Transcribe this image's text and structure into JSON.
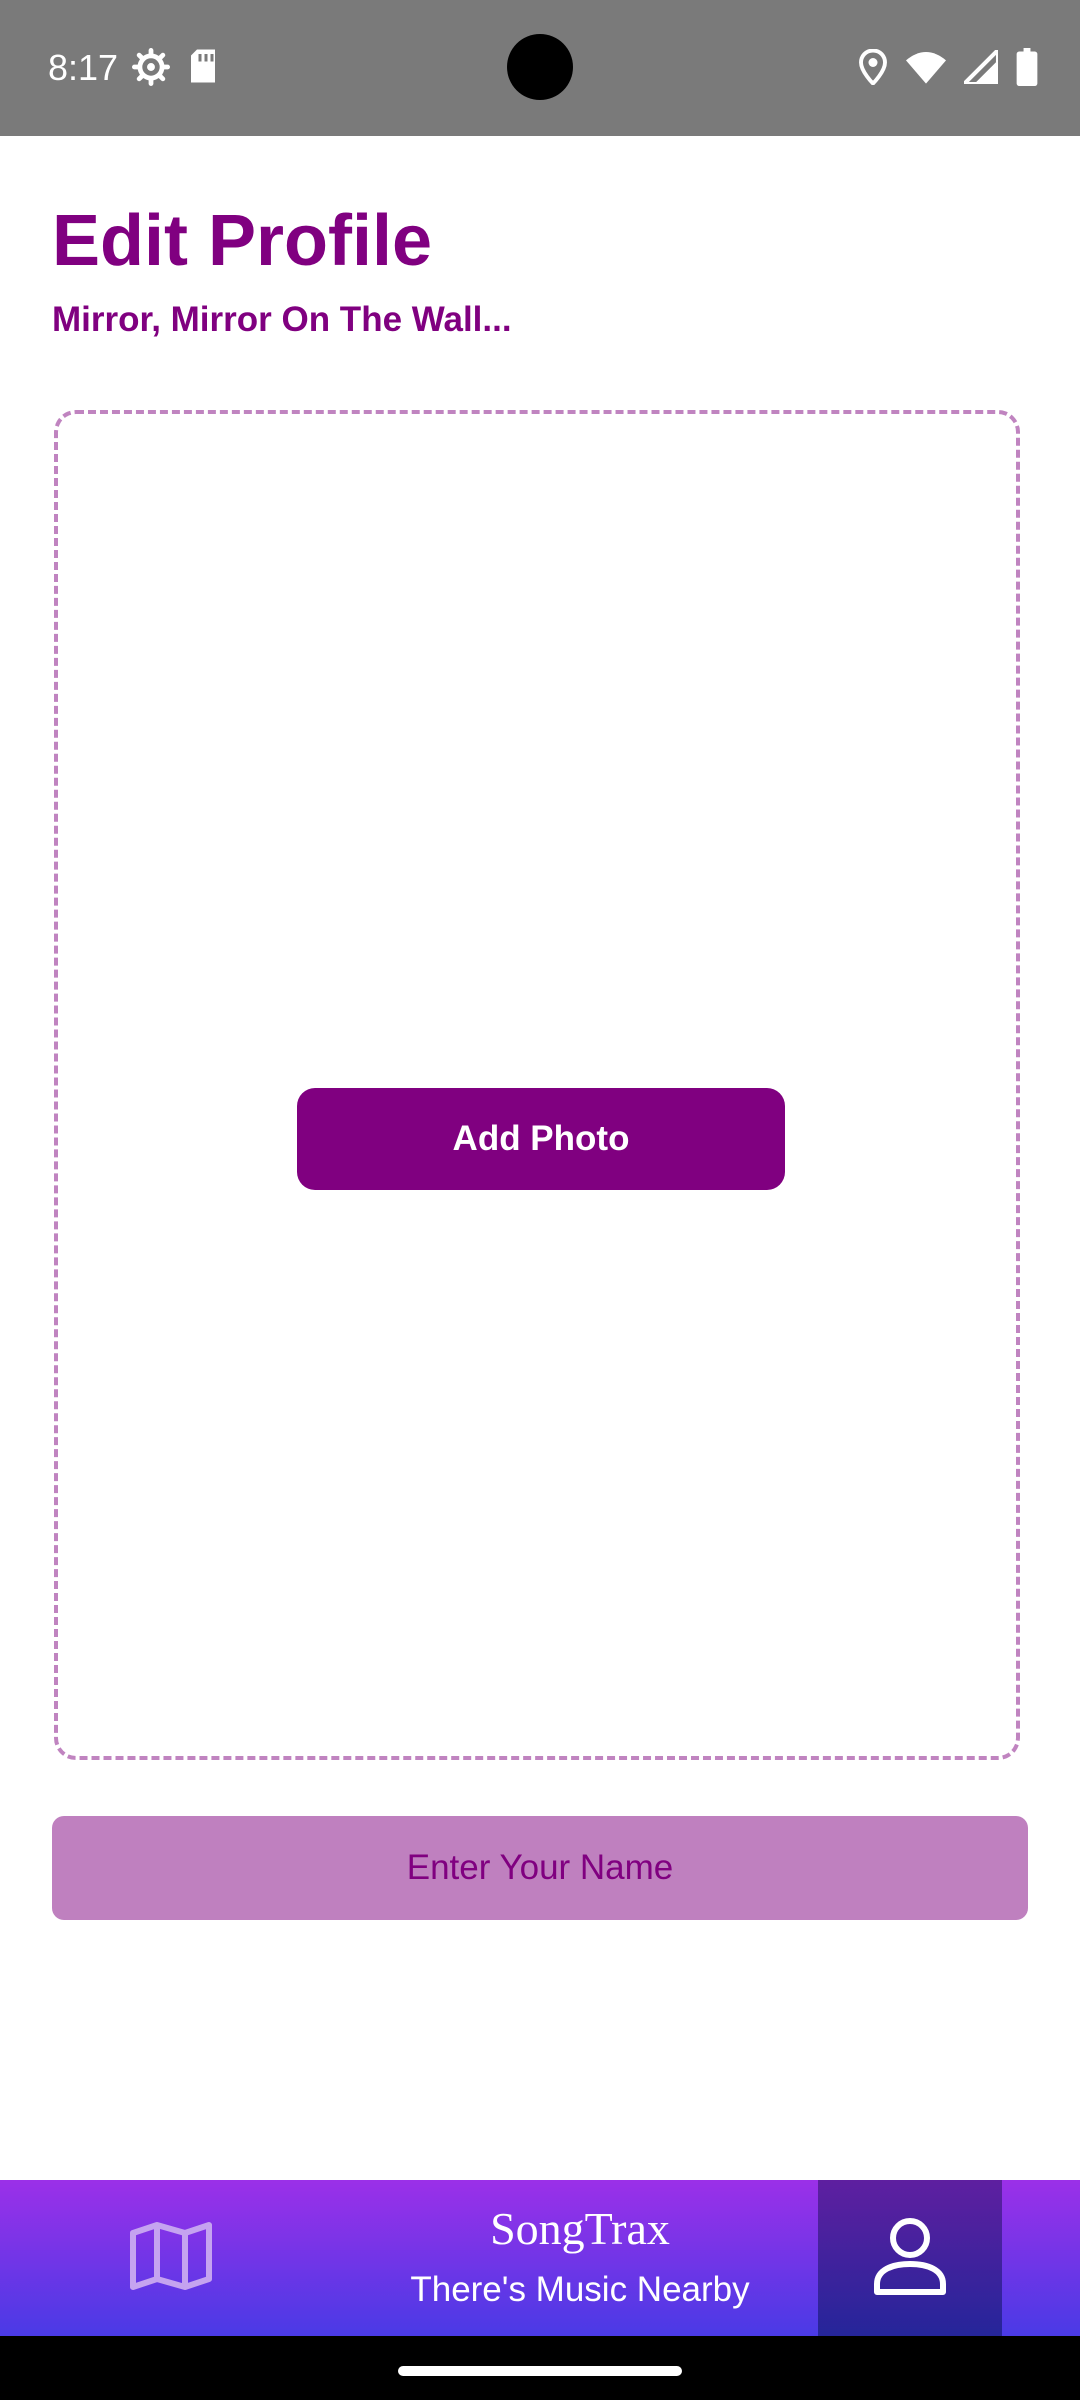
{
  "status_bar": {
    "time": "8:17",
    "left_icons": [
      "settings-gear-icon",
      "sd-card-icon"
    ],
    "right_icons": [
      "location-icon",
      "wifi-icon",
      "cellular-signal-icon",
      "battery-icon"
    ]
  },
  "header": {
    "title": "Edit Profile",
    "subtitle": "Mirror, Mirror On The Wall..."
  },
  "photo_area": {
    "add_photo_label": "Add Photo"
  },
  "name_input": {
    "placeholder": "Enter Your Name",
    "value": ""
  },
  "bottom_nav": {
    "brand_name": "SongTrax",
    "tagline": "There's Music Nearby",
    "items": [
      {
        "icon": "map-icon",
        "active": false
      },
      {
        "icon": "profile-icon",
        "active": true
      }
    ]
  },
  "colors": {
    "primary": "#800080",
    "dashed_border": "#c084c0",
    "input_background": "#bf80bf",
    "nav_gradient_top": "#9b30e8",
    "nav_gradient_bottom": "#4a3ae6",
    "nav_active_top": "#5e1fa0",
    "nav_active_bottom": "#25259a",
    "map_icon": "#c5a3f0",
    "status_bar": "#7a7a7a"
  }
}
